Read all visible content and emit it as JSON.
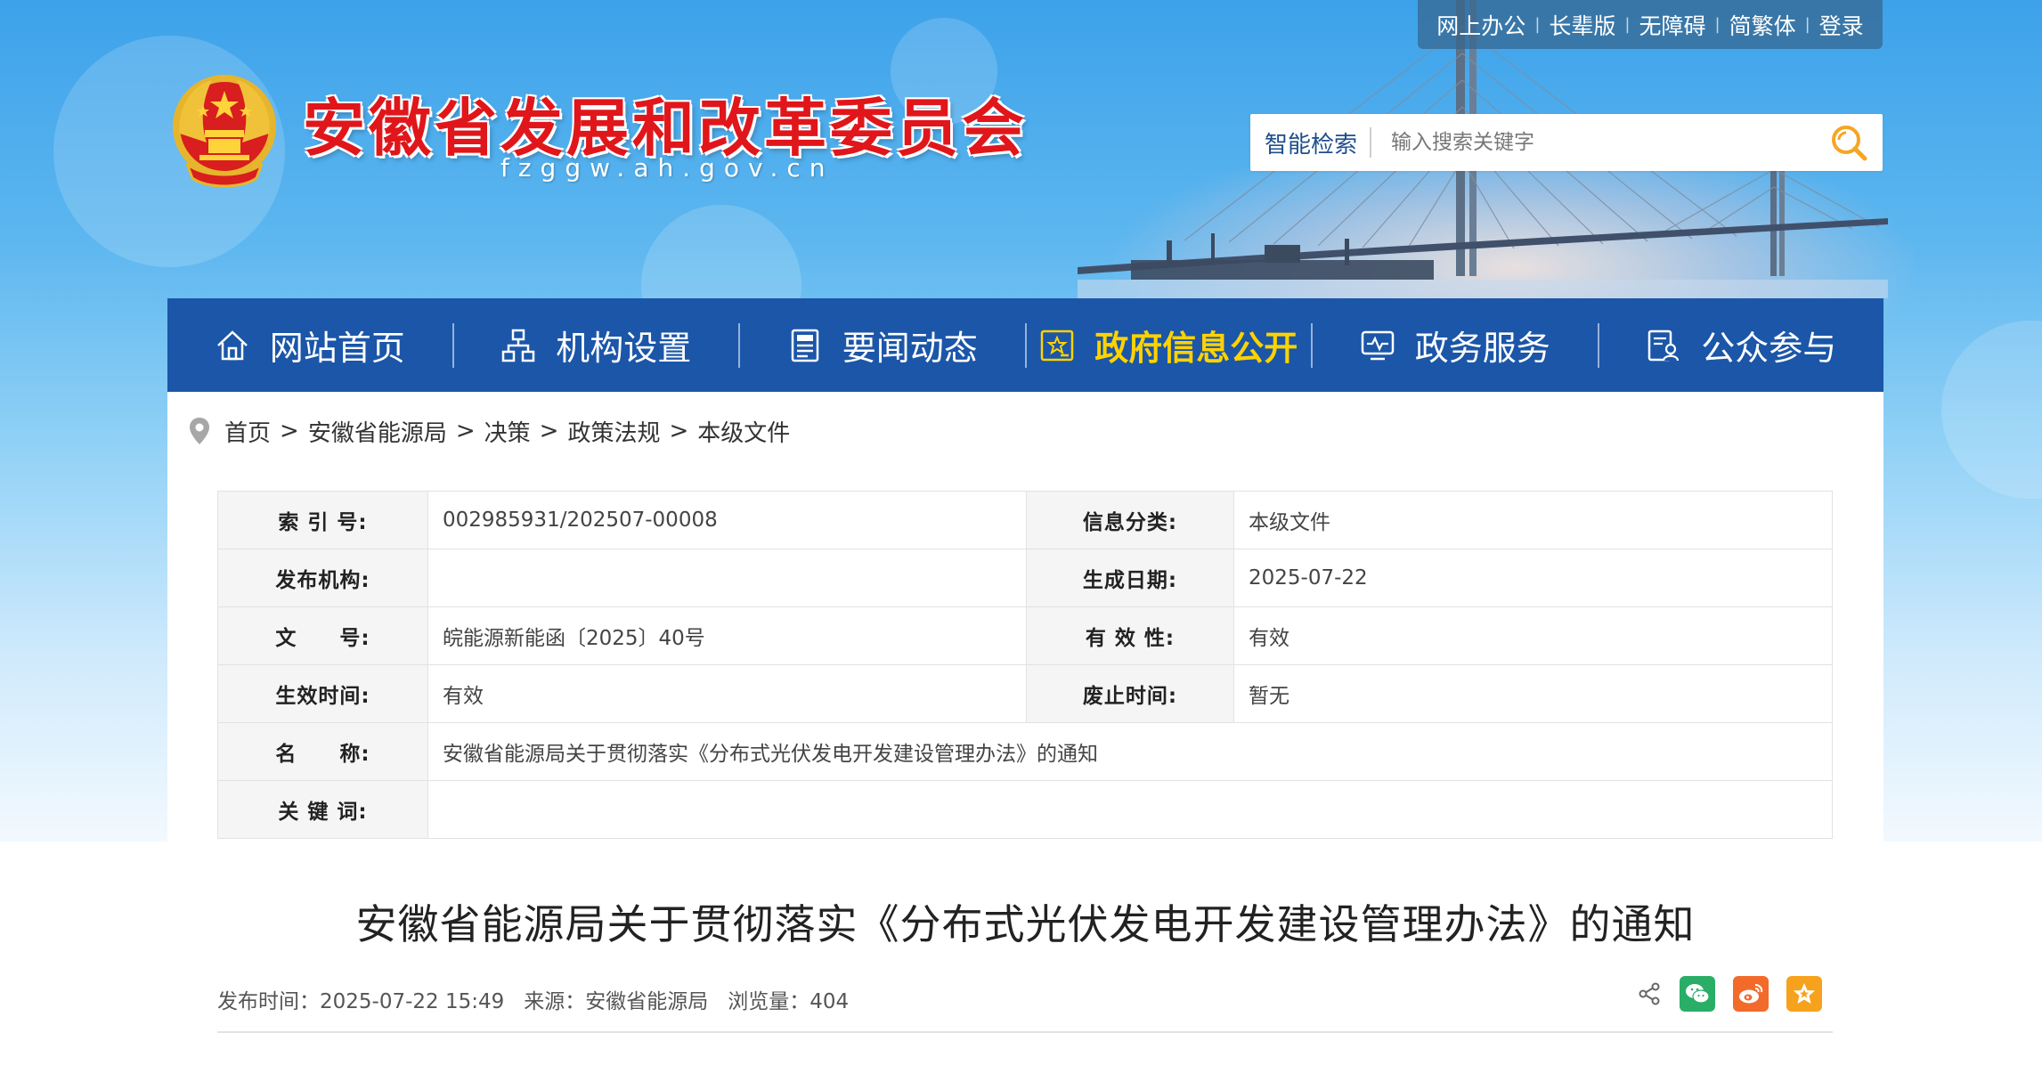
{
  "toplinks": [
    "网上办公",
    "长辈版",
    "无障碍",
    "简繁体",
    "登录"
  ],
  "site": {
    "title": "安徽省发展和改革委员会",
    "domain": "fzggw.ah.gov.cn"
  },
  "search": {
    "label": "智能检索",
    "placeholder": "输入搜索关键字"
  },
  "nav": [
    {
      "label": "网站首页",
      "icon": "home-icon"
    },
    {
      "label": "机构设置",
      "icon": "org-chart-icon"
    },
    {
      "label": "要闻动态",
      "icon": "news-icon"
    },
    {
      "label": "政府信息公开",
      "icon": "info-disclosure-icon",
      "active": true
    },
    {
      "label": "政务服务",
      "icon": "service-monitor-icon"
    },
    {
      "label": "公众参与",
      "icon": "participation-icon"
    }
  ],
  "breadcrumb": [
    "首页",
    "安徽省能源局",
    "决策",
    "政策法规",
    "本级文件"
  ],
  "meta": {
    "index_label": "索 引 号:",
    "index_value": "002985931/202507-00008",
    "category_label": "信息分类:",
    "category_value": "本级文件",
    "publisher_label": "发布机构:",
    "publisher_value": "",
    "date_label": "生成日期:",
    "date_value": "2025-07-22",
    "docno_label": "文　　号:",
    "docno_value": "皖能源新能函〔2025〕40号",
    "validity_label": "有 效 性:",
    "validity_value": "有效",
    "effective_label": "生效时间:",
    "effective_value": "有效",
    "abolish_label": "废止时间:",
    "abolish_value": "暂无",
    "name_label": "名　　称:",
    "name_value": "安徽省能源局关于贯彻落实《分布式光伏发电开发建设管理办法》的通知",
    "keywords_label": "关 键 词:",
    "keywords_value": ""
  },
  "article": {
    "title": "安徽省能源局关于贯彻落实《分布式光伏发电开发建设管理办法》的通知",
    "published": "发布时间：2025-07-22 15:49",
    "source": "来源：安徽省能源局",
    "views": "浏览量：404"
  },
  "colors": {
    "nav_bg": "#1b56a8",
    "nav_active": "#ffd200",
    "title_red": "#e0161b",
    "wechat_green": "#2aae67",
    "weibo_orange": "#f26b2a",
    "favorite_orange": "#f7a21c"
  }
}
